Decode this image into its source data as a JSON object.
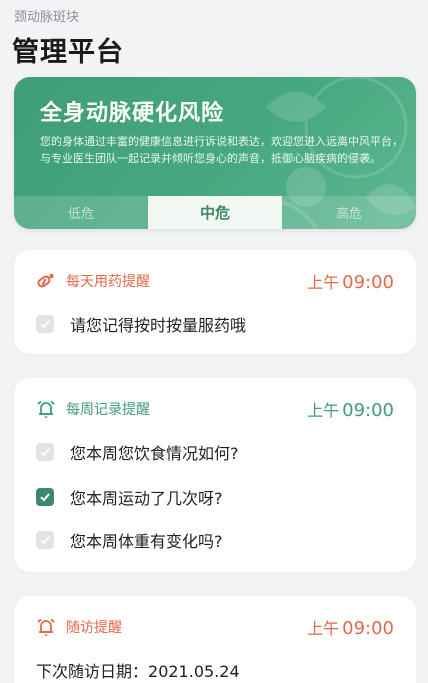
{
  "header": {
    "subtitle": "颈动脉斑块",
    "title": "管理平台"
  },
  "risk_card": {
    "title": "全身动脉硬化风险",
    "description": "您的身体通过丰富的健康信息进行诉说和表达，欢迎您进入远离中风平台，与专业医生团队一起记录并倾听您身心的声音，抵御心脑疾病的侵袭。",
    "levels": [
      {
        "label": "低危",
        "active": false
      },
      {
        "label": "中危",
        "active": true
      },
      {
        "label": "高危",
        "active": false
      }
    ]
  },
  "medication": {
    "name": "每天用药提醒",
    "time_prefix": "上午",
    "time": "09:00",
    "items": [
      {
        "text": "请您记得按时按量服药哦",
        "checked": false
      }
    ]
  },
  "weekly": {
    "name": "每周记录提醒",
    "time_prefix": "上午",
    "time": "09:00",
    "items": [
      {
        "text": "您本周您饮食情况如何?",
        "checked": false
      },
      {
        "text": "您本周运动了几次呀?",
        "checked": true
      },
      {
        "text": "您本周体重有变化吗?",
        "checked": false
      }
    ]
  },
  "followup": {
    "name": "随访提醒",
    "time_prefix": "上午",
    "time": "09:00",
    "date_label": "下次随访日期：",
    "date_value": "2021.05.24"
  },
  "colors": {
    "accent_green": "#3f9d78",
    "accent_orange": "#e4684a",
    "background": "#f2f3f5"
  },
  "icons": {
    "medication": "pill-icon",
    "weekly": "alarm-clock-icon",
    "followup": "alarm-clock-icon",
    "checkbox": "checkmark-icon"
  }
}
